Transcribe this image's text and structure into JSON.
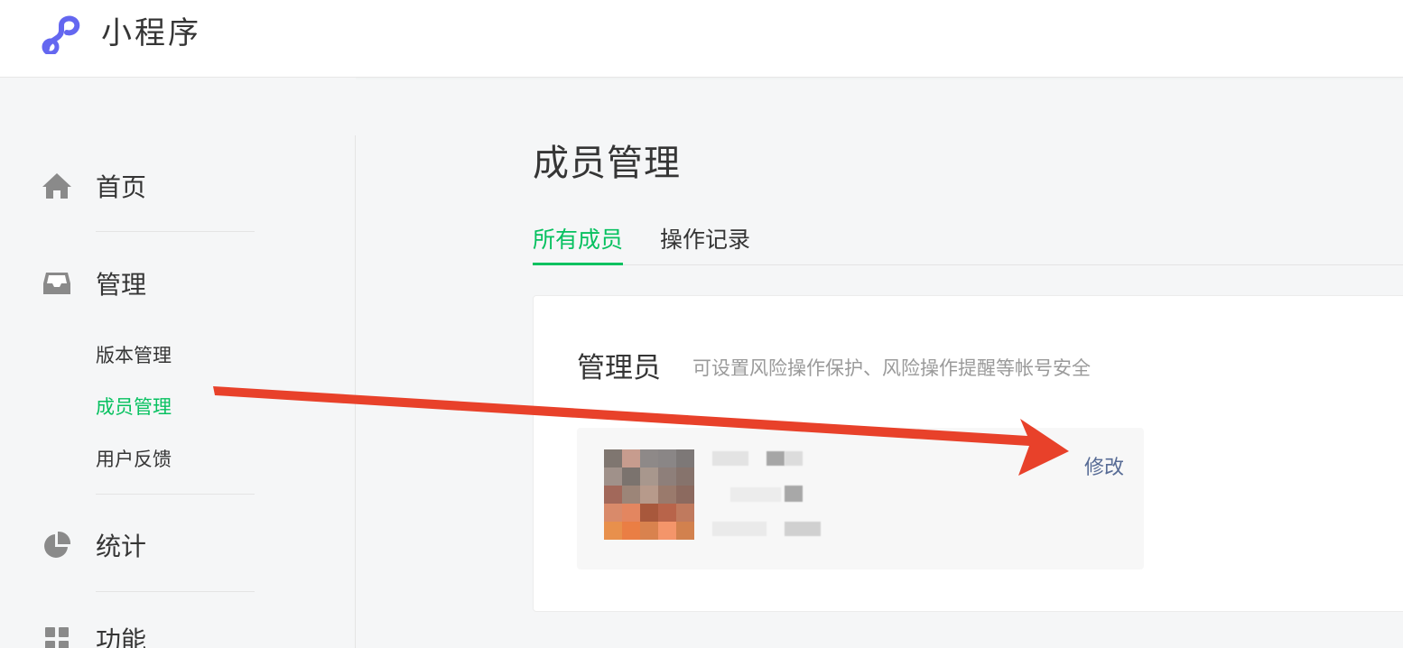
{
  "header": {
    "app_name": "小程序",
    "logo_icon": "mini-program-logo-icon",
    "accent_color": "#6467f0"
  },
  "sidebar": {
    "sections": [
      {
        "label": "首页",
        "icon": "home-icon"
      },
      {
        "label": "管理",
        "icon": "inbox-icon",
        "items": [
          {
            "label": "版本管理",
            "active": false
          },
          {
            "label": "成员管理",
            "active": true
          },
          {
            "label": "用户反馈",
            "active": false
          }
        ]
      },
      {
        "label": "统计",
        "icon": "pie-chart-icon"
      },
      {
        "label": "功能",
        "icon": "grid-icon"
      }
    ],
    "active_color": "#07c160"
  },
  "main": {
    "title": "成员管理",
    "tabs": [
      {
        "label": "所有成员",
        "active": true
      },
      {
        "label": "操作记录",
        "active": false
      }
    ],
    "admin_card": {
      "title": "管理员",
      "description": "可设置风险操作保护、风险操作提醒等帐号安全",
      "edit_label": "修改",
      "link_color": "#576b95"
    }
  },
  "annotation": {
    "arrow_color": "#e8412a"
  }
}
